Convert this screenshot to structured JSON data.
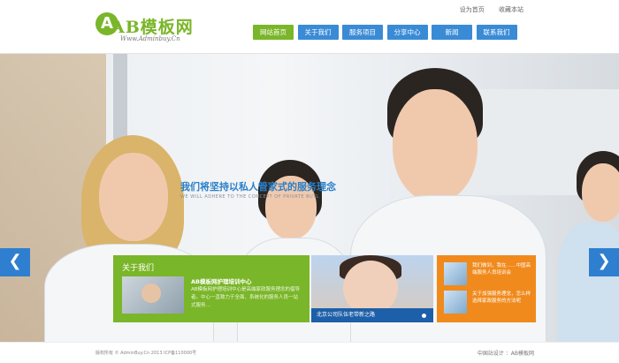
{
  "logo": {
    "mark": "A",
    "name": "AB模板网",
    "subtitle": "Www.Adminbuy.Cn"
  },
  "toplinks": [
    "设为首页",
    "收藏本站"
  ],
  "nav": [
    {
      "label": "网站首页",
      "active": true
    },
    {
      "label": "关于我们",
      "active": false
    },
    {
      "label": "服务项目",
      "active": false
    },
    {
      "label": "分享中心",
      "active": false
    },
    {
      "label": "新闻",
      "active": false
    },
    {
      "label": "联系我们",
      "active": false
    }
  ],
  "hero": {
    "slogan": "我们将坚持以私人管家式的服务理念",
    "slogan_en": "WE WILL ADHERE TO THE CONCEPT OF PRIVATE BUTL",
    "prev_icon": "chevron-left-icon",
    "next_icon": "chevron-right-icon"
  },
  "about": {
    "title": "关于我们",
    "headline": "AB模板网护理培训中心",
    "desc": "AB模板网护理培训中心是高端家政服务理念的倡导者。中心一直致力于全面、系统化的服务人员一站式服务…"
  },
  "photo_caption": "北京公司队伍老带新之路",
  "news": [
    {
      "text": "我们做到，我在……中国高端服务人员培训会"
    },
    {
      "text": "关于加强服务理念，怎么样选择家政服务的方法呢"
    }
  ],
  "footer": {
    "left": "版权所有 © AdminBuy.Cn 2013 ICP备110000号",
    "right": "中国站设计 ：AB模板网"
  },
  "colors": {
    "green": "#7ab629",
    "blue": "#3a8bd6",
    "orange": "#f08a1c",
    "caption_blue": "#1d5fa8"
  }
}
